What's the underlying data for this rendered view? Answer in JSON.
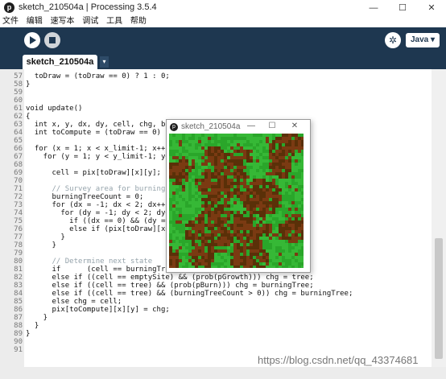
{
  "window": {
    "title": "sketch_210504a | Processing 3.5.4",
    "minimize": "—",
    "maximize": "☐",
    "close": "✕"
  },
  "menu": [
    "文件",
    "编辑",
    "速写本",
    "调试",
    "工具",
    "帮助"
  ],
  "toolbar": {
    "run_icon": "play-icon",
    "stop_icon": "stop-icon",
    "debug_icon": "butterfly-icon",
    "mode_label": "Java ▾"
  },
  "tab": {
    "name": "sketch_210504a",
    "dropdown": "▾"
  },
  "code_lines": [
    {
      "n": "57",
      "t": "  toDraw = (toDraw == 0) ? 1 : 0;"
    },
    {
      "n": "58",
      "t": "}"
    },
    {
      "n": "59",
      "t": ""
    },
    {
      "n": "60",
      "t": ""
    },
    {
      "n": "61",
      "t": "void update()"
    },
    {
      "n": "62",
      "t": "{"
    },
    {
      "n": "63",
      "t": "  int x, y, dx, dy, cell, chg, burningT"
    },
    {
      "n": "64",
      "t": "  int toCompute = (toDraw == 0) ? 1 :"
    },
    {
      "n": "65",
      "t": ""
    },
    {
      "n": "66",
      "t": "  for (x = 1; x < x_limit-1; x++) {"
    },
    {
      "n": "67",
      "t": "    for (y = 1; y < y_limit-1; y++) {"
    },
    {
      "n": "68",
      "t": ""
    },
    {
      "n": "69",
      "t": "      cell = pix[toDraw][x][y];"
    },
    {
      "n": "70",
      "t": ""
    },
    {
      "n": "71",
      "t": "      // Survey area for burning trees"
    },
    {
      "n": "72",
      "t": "      burningTreeCount = 0;"
    },
    {
      "n": "73",
      "t": "      for (dx = -1; dx < 2; dx++) {"
    },
    {
      "n": "74",
      "t": "        for (dy = -1; dy < 2; dy++) {"
    },
    {
      "n": "75",
      "t": "          if ((dx == 0) && (dy == 0))"
    },
    {
      "n": "76",
      "t": "          else if (pix[toDraw][x+dx][                       nt++;"
    },
    {
      "n": "77",
      "t": "        }"
    },
    {
      "n": "78",
      "t": "      }"
    },
    {
      "n": "79",
      "t": ""
    },
    {
      "n": "80",
      "t": "      // Determine next state"
    },
    {
      "n": "81",
      "t": "      if      (cell == burningTree) c"
    },
    {
      "n": "82",
      "t": "      else if ((cell == emptySite) && (prob(pGrowth))) chg = tree;"
    },
    {
      "n": "83",
      "t": "      else if ((cell == tree) && (prob(pBurn))) chg = burningTree;"
    },
    {
      "n": "84",
      "t": "      else if ((cell == tree) && (burningTreeCount > 0)) chg = burningTree;"
    },
    {
      "n": "85",
      "t": "      else chg = cell;"
    },
    {
      "n": "86",
      "t": "      pix[toCompute][x][y] = chg;"
    },
    {
      "n": "87",
      "t": "    }"
    },
    {
      "n": "88",
      "t": "  }"
    },
    {
      "n": "89",
      "t": "}"
    },
    {
      "n": "90",
      "t": ""
    },
    {
      "n": "91",
      "t": ""
    }
  ],
  "sketch": {
    "title": "sketch_210504a",
    "minimize": "—",
    "maximize": "☐",
    "close": "✕",
    "colors": {
      "tree": "#2aa62a",
      "burnt": "#7a3a12",
      "empty": "#5a3008"
    }
  },
  "watermark": "https://blog.csdn.net/qq_43374681",
  "colors": {
    "toolbar_bg": "#1e3750",
    "keyword": "#33997e",
    "type": "#e2661a",
    "comment": "#95a3ab"
  }
}
